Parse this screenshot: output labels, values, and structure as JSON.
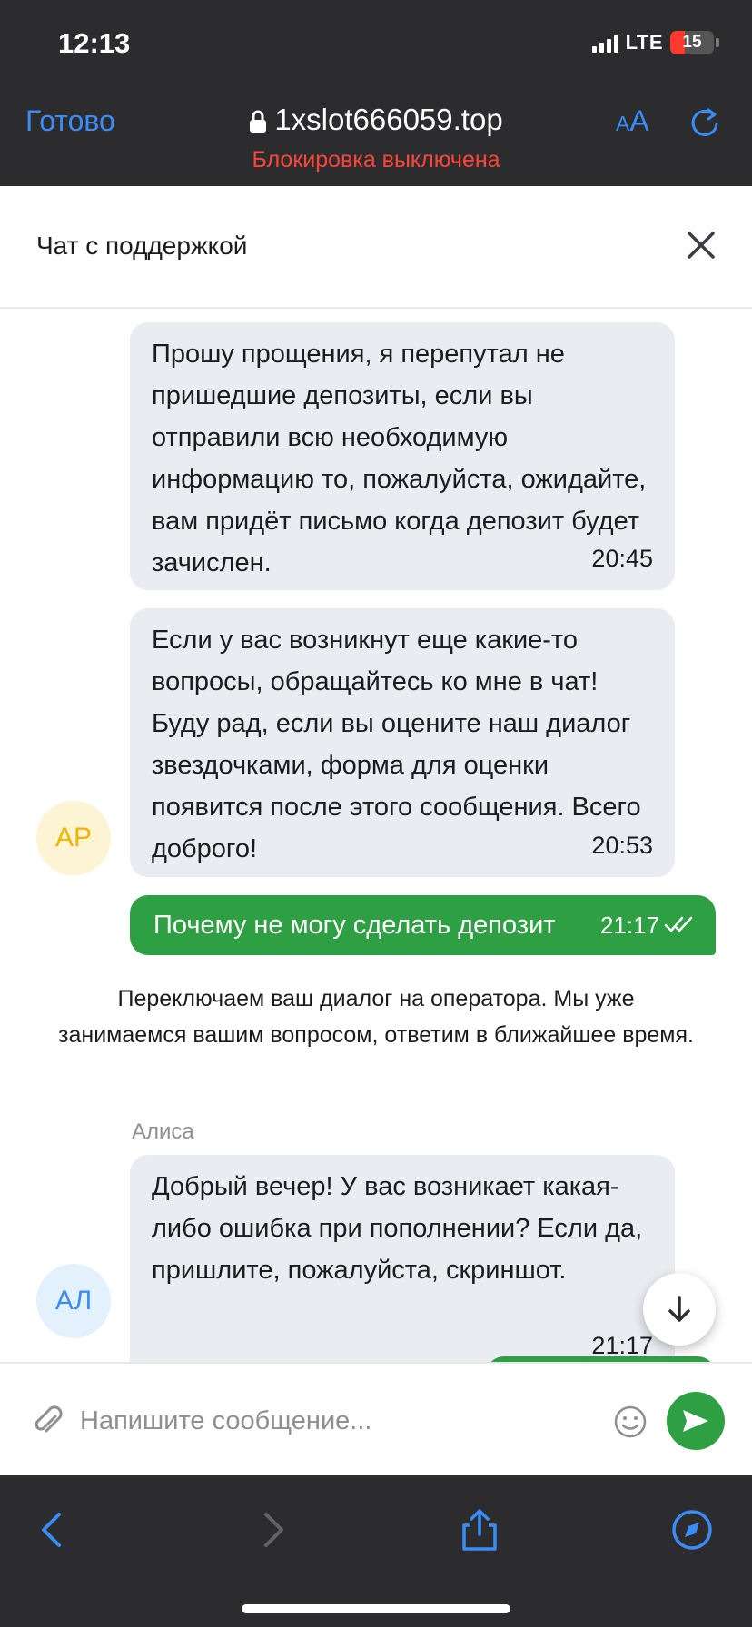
{
  "status_bar": {
    "time": "12:13",
    "network": "LTE",
    "battery": "15",
    "battery_level_percent": 15
  },
  "browser": {
    "done_label": "Готово",
    "url": "1xslot666059.top",
    "block_state": "Блокировка выключена",
    "text_size_small": "A",
    "text_size_large": "A",
    "colors": {
      "accent": "#3a8cf7",
      "warning": "#ff453a",
      "chrome_bg": "#2c2c2e"
    }
  },
  "chat": {
    "title": "Чат с поддержкой",
    "messages": [
      {
        "text": "Прошу прощения, я перепутал не пришедшие депозиты, если вы отправили всю необходимую информацию то, пожалуйста, ожидайте, вам придёт письмо когда депозит будет зачислен.",
        "time": "20:45"
      },
      {
        "text": "Если у вас возникнут еще какие-то вопросы, обращайтесь ко мне в чат! Буду рад, если вы оцените наш диалог звездочками, форма для оценки появится после этого сообщения. Всего доброго!",
        "time": "20:53",
        "avatar": "АР"
      },
      {
        "text": "Почему не могу сделать депозит",
        "time": "21:17",
        "status_icon": "double-check-icon"
      },
      {
        "system": "Переключаем ваш диалог на оператора. Мы уже занимаемся вашим вопросом, ответим в ближайшее время."
      },
      {
        "sender": "Алиса",
        "text": "Добрый вечер! У вас возникает какая-либо ошибка при пополнении? Если да, пришлите, пожалуйста, скриншот.",
        "time": "21:17",
        "avatar": "АЛ"
      }
    ],
    "colors": {
      "incoming_bg": "#e9ecf0",
      "outgoing_bg": "#2ea043",
      "avatar1_bg": "#fdf4d3",
      "avatar1_fg": "#f0b400",
      "avatar2_bg": "#e3f1fc",
      "avatar2_fg": "#3a8cf7"
    }
  },
  "composer": {
    "placeholder": "Напишите сообщение..."
  }
}
